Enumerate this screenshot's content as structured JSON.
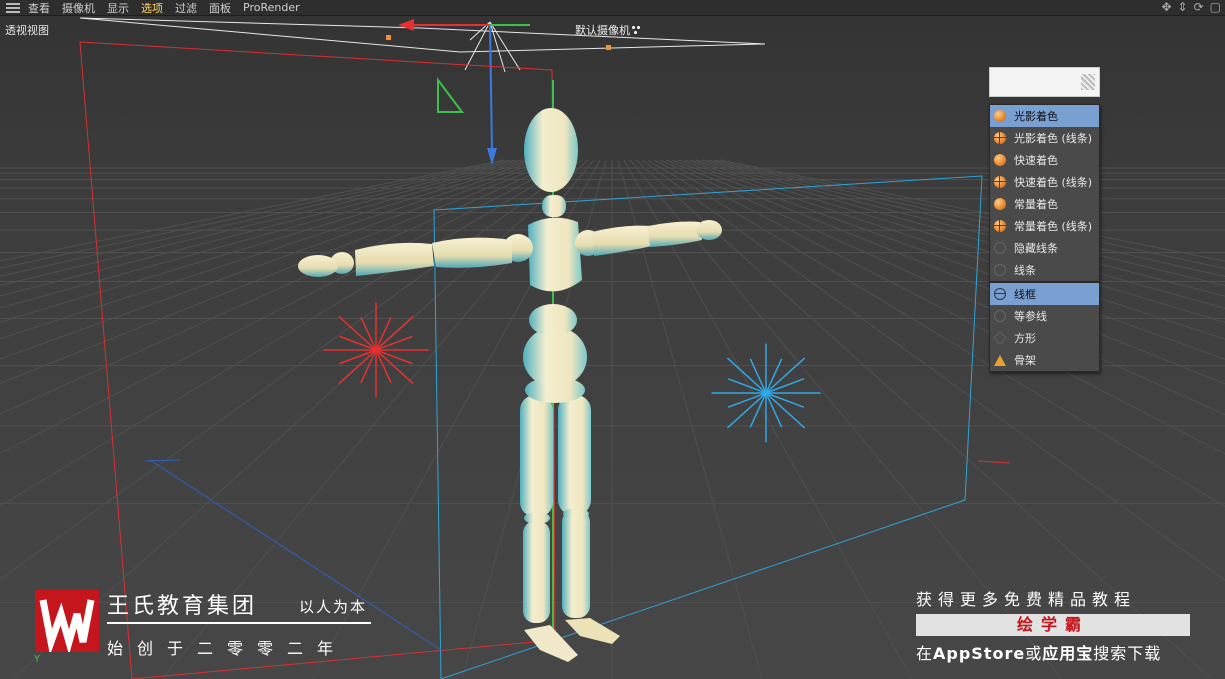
{
  "menubar": {
    "items": [
      {
        "label": "查看",
        "active": false
      },
      {
        "label": "摄像机",
        "active": false
      },
      {
        "label": "显示",
        "active": false
      },
      {
        "label": "选项",
        "active": true
      },
      {
        "label": "过滤",
        "active": false
      },
      {
        "label": "面板",
        "active": false
      },
      {
        "label": "ProRender",
        "active": false
      }
    ],
    "nav_icons": [
      "move-view-icon",
      "dolly-view-icon",
      "rotate-view-icon",
      "maximize-view-icon"
    ]
  },
  "viewport": {
    "view_name": "透视视图",
    "camera_name": "默认摄像机",
    "axis_label": "Y"
  },
  "display_menu": {
    "shading_items": [
      {
        "label": "光影着色",
        "icon": "shaded-sphere-icon",
        "selected": true
      },
      {
        "label": "光影着色 (线条)",
        "icon": "shaded-lines-sphere-icon",
        "selected": false
      },
      {
        "label": "快速着色",
        "icon": "quick-shading-icon",
        "selected": false
      },
      {
        "label": "快速着色 (线条)",
        "icon": "quick-shading-lines-icon",
        "selected": false
      },
      {
        "label": "常量着色",
        "icon": "constant-shading-icon",
        "selected": false
      },
      {
        "label": "常量着色 (线条)",
        "icon": "constant-shading-lines-icon",
        "selected": false
      },
      {
        "label": "隐藏线条",
        "icon": "hidden-line-icon",
        "selected": false
      },
      {
        "label": "线条",
        "icon": "lines-icon",
        "selected": false
      }
    ],
    "display_items": [
      {
        "label": "线框",
        "icon": "wireframe-icon",
        "selected": true
      },
      {
        "label": "等参线",
        "icon": "isoparms-icon",
        "selected": false
      },
      {
        "label": "方形",
        "icon": "box-icon",
        "selected": false
      },
      {
        "label": "骨架",
        "icon": "skeleton-icon",
        "selected": false
      }
    ]
  },
  "watermark": {
    "company": "王氏教育集团",
    "slogan": "以人为本",
    "founded": "始创于二零零二年",
    "more_tutorials": "获得更多免费精品教程",
    "brand": "绘学霸",
    "download_prefix": "在",
    "store1": "AppStore",
    "connector": "或",
    "store2": "应用宝",
    "download_suffix": "搜索下载"
  },
  "colors": {
    "menu_active": "#ffd95a",
    "menu_selected": "#7a9fd1",
    "light_red": "#e83030",
    "light_blue": "#30a8e8",
    "brand_red": "#c4161c"
  }
}
